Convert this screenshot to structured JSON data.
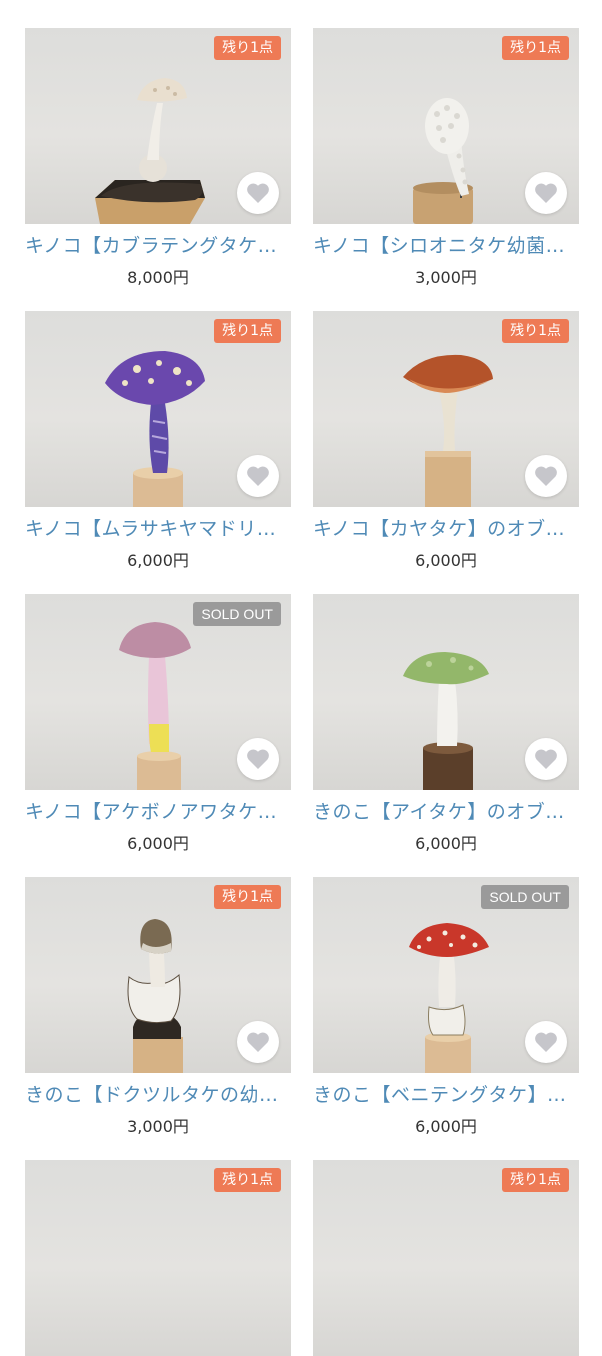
{
  "colors": {
    "badge_remaining": "#ee7a55",
    "badge_sold_out": "#9a9a9a",
    "title_link": "#4f8ab6",
    "price_text": "#333333",
    "favorite_heart": "#c6c6cb"
  },
  "products": [
    {
      "title": "キノコ【カブラテングタケ…",
      "price": "8,000円",
      "badge": "残り1点",
      "image": "white-mushroom-on-soil-icon"
    },
    {
      "title": "キノコ【シロオニタケ幼菌…",
      "price": "3,000円",
      "badge": "残り1点",
      "image": "white-warty-mushroom-icon"
    },
    {
      "title": "キノコ【ムラサキヤマドリ…",
      "price": "6,000円",
      "badge": "残り1点",
      "image": "purple-spotted-mushroom-icon"
    },
    {
      "title": "キノコ【カヤタケ】のオブ…",
      "price": "6,000円",
      "badge": "残り1点",
      "image": "orange-funnel-mushroom-icon"
    },
    {
      "title": "キノコ【アケボノアワタケ…",
      "price": "6,000円",
      "badge": "SOLD OUT",
      "image": "pink-yellow-mushroom-icon"
    },
    {
      "title": "きのこ【アイタケ】のオブ…",
      "price": "6,000円",
      "badge": "",
      "image": "green-cap-mushroom-icon"
    },
    {
      "title": "きのこ【ドクツルタケの幼…",
      "price": "3,000円",
      "badge": "残り1点",
      "image": "brown-egg-mushroom-icon"
    },
    {
      "title": "きのこ【ベニテングタケ】…",
      "price": "6,000円",
      "badge": "SOLD OUT",
      "image": "red-fly-agaric-icon"
    },
    {
      "title": "",
      "price": "",
      "badge": "残り1点",
      "image": ""
    },
    {
      "title": "",
      "price": "",
      "badge": "残り1点",
      "image": ""
    }
  ]
}
